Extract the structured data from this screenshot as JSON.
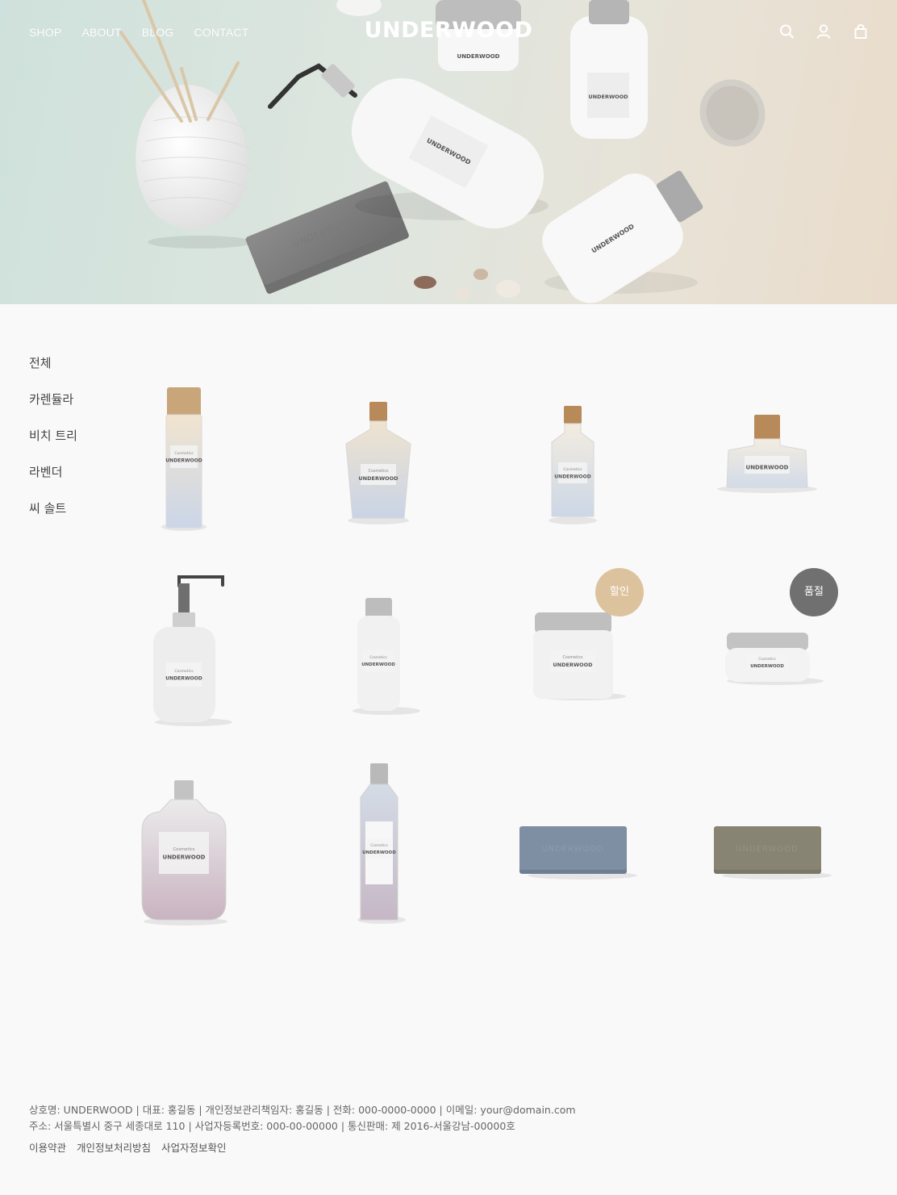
{
  "nav": {
    "items": [
      {
        "label": "SHOP"
      },
      {
        "label": "ABOUT"
      },
      {
        "label": "BLOG"
      },
      {
        "label": "CONTACT"
      }
    ]
  },
  "brand": {
    "logo": "UNDERWOOD",
    "label_text": "Cosmetics"
  },
  "header_icons": [
    "search-icon",
    "user-icon",
    "cart-icon"
  ],
  "sidebar": {
    "categories": [
      {
        "label": "전체"
      },
      {
        "label": "카렌듈라"
      },
      {
        "label": "비치 트리"
      },
      {
        "label": "라벤더"
      },
      {
        "label": "씨 솔트"
      }
    ]
  },
  "products": [
    {
      "kind": "tall-bottle"
    },
    {
      "kind": "cork-flask"
    },
    {
      "kind": "cork-bottle"
    },
    {
      "kind": "cork-jar"
    },
    {
      "kind": "pump-bottle"
    },
    {
      "kind": "white-bottle"
    },
    {
      "kind": "tall-jar",
      "badge": {
        "text": "할인",
        "color": "#ddc29e"
      }
    },
    {
      "kind": "flat-jar",
      "badge": {
        "text": "품절",
        "color": "#707070"
      }
    },
    {
      "kind": "square-bottle"
    },
    {
      "kind": "slim-bottle"
    },
    {
      "kind": "soap-blue"
    },
    {
      "kind": "soap-olive"
    }
  ],
  "footer": {
    "line1": "상호명: UNDERWOOD | 대표: 홍길동 | 개인정보관리책임자: 홍길동 | 전화: 000-0000-0000 | 이메일: your@domain.com",
    "line2": "주소: 서울특별시 중구 세종대로 110 | 사업자등록번호: 000-00-00000 | 통신판매: 제 2016-서울강남-00000호",
    "links": [
      {
        "label": "이용약관"
      },
      {
        "label": "개인정보처리방침"
      },
      {
        "label": "사업자정보확인"
      }
    ]
  }
}
